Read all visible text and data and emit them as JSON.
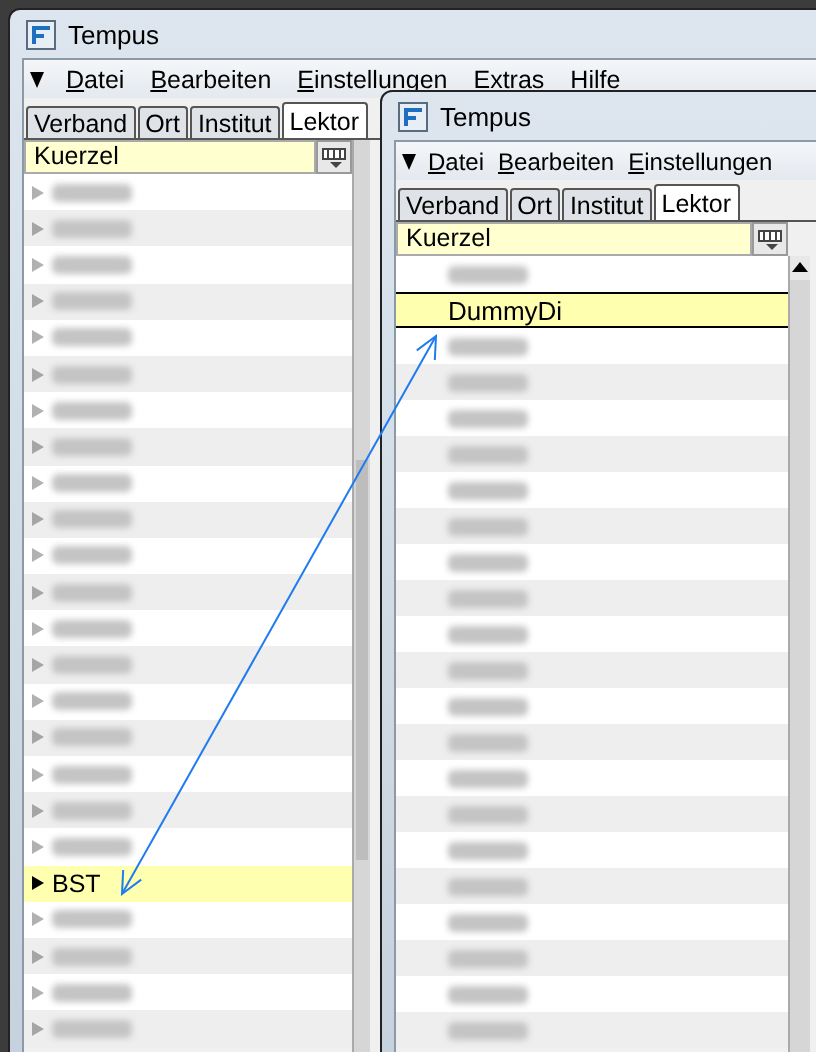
{
  "windows": [
    {
      "title": "Tempus",
      "menu": [
        "Datei",
        "Bearbeiten",
        "Einstellungen",
        "Extras",
        "Hilfe"
      ],
      "tabs": [
        {
          "label": "Verband",
          "selected": false
        },
        {
          "label": "Ort",
          "selected": false
        },
        {
          "label": "Institut",
          "selected": false
        },
        {
          "label": "Lektor",
          "selected": true
        }
      ],
      "column_header": "Kuerzel",
      "rows": [
        {
          "redacted": true,
          "selected": false
        },
        {
          "redacted": true,
          "selected": false
        },
        {
          "redacted": true,
          "selected": false
        },
        {
          "redacted": true,
          "selected": false
        },
        {
          "redacted": true,
          "selected": false
        },
        {
          "redacted": true,
          "selected": false
        },
        {
          "redacted": true,
          "selected": false
        },
        {
          "redacted": true,
          "selected": false
        },
        {
          "redacted": true,
          "selected": false
        },
        {
          "redacted": true,
          "selected": false
        },
        {
          "redacted": true,
          "selected": false
        },
        {
          "redacted": true,
          "selected": false
        },
        {
          "redacted": true,
          "selected": false
        },
        {
          "redacted": true,
          "selected": false
        },
        {
          "redacted": true,
          "selected": false
        },
        {
          "redacted": true,
          "selected": false
        },
        {
          "redacted": true,
          "selected": false
        },
        {
          "redacted": true,
          "selected": false
        },
        {
          "redacted": true,
          "selected": false
        },
        {
          "label": "BST",
          "redacted": false,
          "selected": true
        },
        {
          "redacted": true,
          "selected": false
        },
        {
          "redacted": true,
          "selected": false
        },
        {
          "redacted": true,
          "selected": false
        },
        {
          "redacted": true,
          "selected": false
        }
      ]
    },
    {
      "title": "Tempus",
      "menu": [
        "Datei",
        "Bearbeiten",
        "Einstellungen"
      ],
      "tabs": [
        {
          "label": "Verband",
          "selected": false
        },
        {
          "label": "Ort",
          "selected": false
        },
        {
          "label": "Institut",
          "selected": false
        },
        {
          "label": "Lektor",
          "selected": true
        }
      ],
      "column_header": "Kuerzel",
      "rows": [
        {
          "redacted": true,
          "selected": false
        },
        {
          "label": "DummyDi",
          "redacted": false,
          "selected": true
        },
        {
          "redacted": true,
          "selected": false
        },
        {
          "redacted": true,
          "selected": false
        },
        {
          "redacted": true,
          "selected": false
        },
        {
          "redacted": true,
          "selected": false
        },
        {
          "redacted": true,
          "selected": false
        },
        {
          "redacted": true,
          "selected": false
        },
        {
          "redacted": true,
          "selected": false
        },
        {
          "redacted": true,
          "selected": false
        },
        {
          "redacted": true,
          "selected": false
        },
        {
          "redacted": true,
          "selected": false
        },
        {
          "redacted": true,
          "selected": false
        },
        {
          "redacted": true,
          "selected": false
        },
        {
          "redacted": true,
          "selected": false
        },
        {
          "redacted": true,
          "selected": false
        },
        {
          "redacted": true,
          "selected": false
        },
        {
          "redacted": true,
          "selected": false
        },
        {
          "redacted": true,
          "selected": false
        },
        {
          "redacted": true,
          "selected": false
        },
        {
          "redacted": true,
          "selected": false
        },
        {
          "redacted": true,
          "selected": false
        }
      ]
    }
  ]
}
